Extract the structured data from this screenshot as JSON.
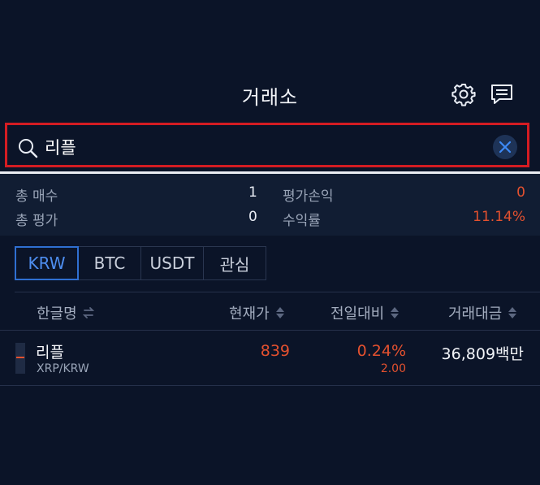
{
  "header": {
    "title": "거래소",
    "settings_icon": "gear-icon",
    "chat_icon": "chat-icon"
  },
  "search": {
    "value": "리플",
    "icon": "search-icon",
    "clear_icon": "close-icon"
  },
  "summary": {
    "total_count_label": "총 매수",
    "total_count_value": "1",
    "total_eval_label": "총 평가",
    "total_eval_value": "0",
    "pnl_label": "평가손익",
    "pnl_value": "0",
    "return_label": "수익률",
    "return_value": "11.14%"
  },
  "tabs": [
    {
      "label": "KRW",
      "active": true
    },
    {
      "label": "BTC",
      "active": false
    },
    {
      "label": "USDT",
      "active": false
    },
    {
      "label": "관심",
      "active": false
    }
  ],
  "columns": {
    "name": "한글명",
    "price": "현재가",
    "change": "전일대비",
    "volume": "거래대금"
  },
  "rows": [
    {
      "name": "리플",
      "pair": "XRP/KRW",
      "price": "839",
      "change_pct": "0.24%",
      "change_amt": "2.00",
      "volume": "36,809백만"
    }
  ],
  "colors": {
    "background": "#0b1428",
    "accent": "#2f6fd1",
    "up": "#e4512f",
    "highlight_border": "#d41c22"
  }
}
